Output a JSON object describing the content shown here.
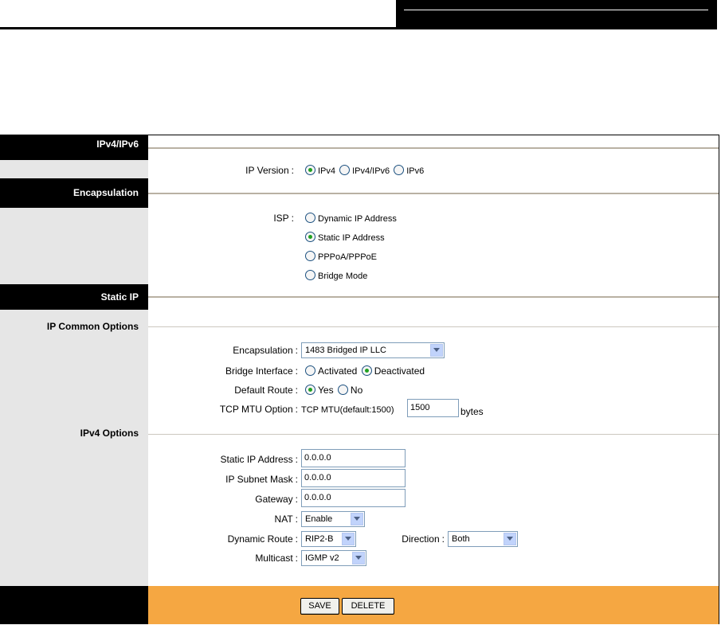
{
  "ipv46": {
    "section_title": "IPv4/IPv6",
    "ip_version_label": "IP Version",
    "options": [
      "IPv4",
      "IPv4/IPv6",
      "IPv6"
    ],
    "selected": "IPv4"
  },
  "encapsulation_section": {
    "section_title": "Encapsulation",
    "isp_label": "ISP",
    "options": [
      "Dynamic IP Address",
      "Static IP Address",
      "PPPoA/PPPoE",
      "Bridge Mode"
    ],
    "selected": "Static IP Address"
  },
  "static_ip": {
    "section_title": "Static IP",
    "common_title": "IP Common Options",
    "encapsulation_label": "Encapsulation",
    "encapsulation_value": "1483 Bridged IP LLC",
    "bridge_interface_label": "Bridge Interface",
    "bridge_options": [
      "Activated",
      "Deactivated"
    ],
    "bridge_selected": "Deactivated",
    "default_route_label": "Default Route",
    "default_route_options": [
      "Yes",
      "No"
    ],
    "default_route_selected": "Yes",
    "tcp_mtu_label": "TCP MTU Option",
    "tcp_mtu_prefix": "TCP MTU(default:1500)",
    "tcp_mtu_value": "1500",
    "tcp_mtu_unit": "bytes"
  },
  "ipv4_options": {
    "title": "IPv4 Options",
    "static_ip_label": "Static IP Address",
    "static_ip_value": "0.0.0.0",
    "subnet_label": "IP Subnet Mask",
    "subnet_value": "0.0.0.0",
    "gateway_label": "Gateway",
    "gateway_value": "0.0.0.0",
    "nat_label": "NAT",
    "nat_value": "Enable",
    "dynamic_route_label": "Dynamic Route",
    "dynamic_route_value": "RIP2-B",
    "direction_label": "Direction",
    "direction_value": "Both",
    "multicast_label": "Multicast",
    "multicast_value": "IGMP v2"
  },
  "footer": {
    "save_label": "SAVE",
    "delete_label": "DELETE"
  },
  "colors": {
    "section_header_bg": "#000000",
    "left_column_bg": "#e6e6e6",
    "footer_bg": "#f5a742",
    "radio_selected_dot": "#21a121"
  }
}
